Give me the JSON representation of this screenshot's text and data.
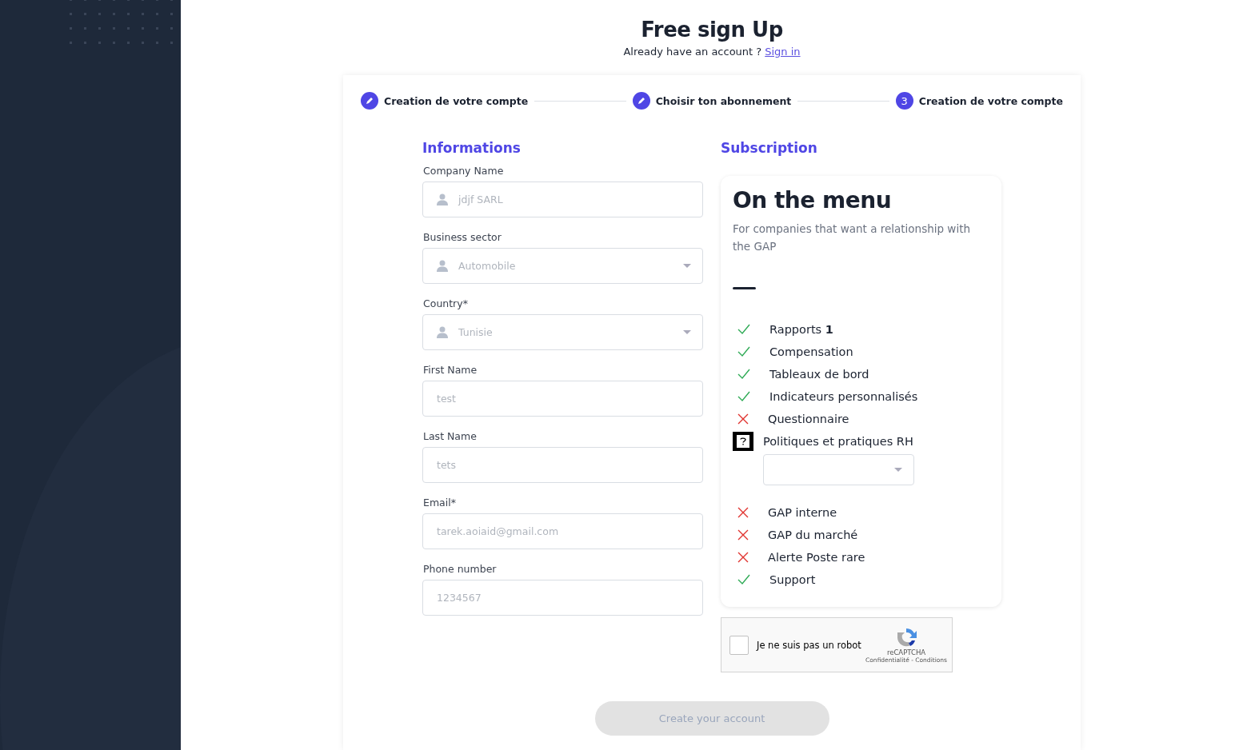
{
  "header": {
    "title": "Free sign Up",
    "prompt": "Already have an account ?",
    "link": "Sign in"
  },
  "steps": [
    {
      "kind": "done",
      "label": "Creation de votre compte"
    },
    {
      "kind": "done",
      "label": "Choisir ton abonnement"
    },
    {
      "kind": "current",
      "number": "3",
      "label": "Creation de votre compte"
    }
  ],
  "informations": {
    "heading": "Informations",
    "fields": [
      {
        "kind": "text",
        "label": "Company Name",
        "value": "jdjf SARL",
        "icon": true
      },
      {
        "kind": "select",
        "label": "Business sector",
        "value": "Automobile",
        "icon": true
      },
      {
        "kind": "select",
        "label": "Country*",
        "value": "Tunisie",
        "icon": true
      },
      {
        "kind": "text",
        "label": "First Name",
        "value": "test",
        "icon": false
      },
      {
        "kind": "text",
        "label": "Last Name",
        "value": "tets",
        "icon": false
      },
      {
        "kind": "text",
        "label": "Email*",
        "value": "tarek.aoiaid@gmail.com",
        "icon": false
      },
      {
        "kind": "text",
        "label": "Phone number",
        "value": "1234567",
        "icon": false
      }
    ]
  },
  "subscription": {
    "heading": "Subscription",
    "plan": {
      "title": "On the menu",
      "description": "For companies that want a relationship with the GAP",
      "features": [
        {
          "kind": "included",
          "label": "Rapports **1**",
          "dropdown": false
        },
        {
          "kind": "included",
          "label": "Compensation",
          "dropdown": false
        },
        {
          "kind": "included",
          "label": "Tableaux de bord",
          "dropdown": false
        },
        {
          "kind": "included",
          "label": "Indicateurs personnalisés",
          "dropdown": false
        },
        {
          "kind": "excluded",
          "label": "Questionnaire",
          "dropdown": false
        },
        {
          "kind": "unknown",
          "label": "Politiques et pratiques RH",
          "dropdown": true
        },
        {
          "kind": "excluded",
          "label": "GAP interne",
          "dropdown": false
        },
        {
          "kind": "excluded",
          "label": "GAP du marché",
          "dropdown": false
        },
        {
          "kind": "excluded",
          "label": "Alerte Poste rare",
          "dropdown": false
        },
        {
          "kind": "included",
          "label": "Support",
          "dropdown": false
        }
      ]
    },
    "captcha": {
      "checked": false,
      "label": "Je ne suis pas un robot",
      "brand": "reCAPTCHA",
      "links": "Confidentialité - Conditions"
    }
  },
  "submit": {
    "label": "Create your account",
    "disabled": true
  }
}
